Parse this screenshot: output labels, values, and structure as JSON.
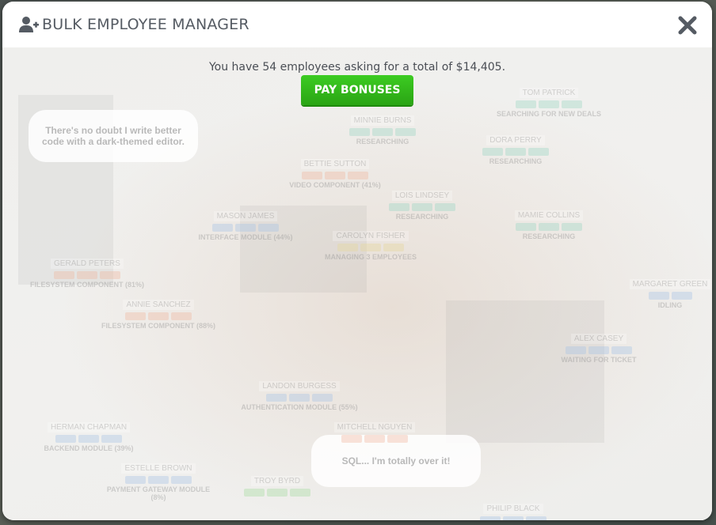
{
  "modal": {
    "title": "BULK EMPLOYEE MANAGER",
    "icon": "add-user-icon",
    "close_icon": "close-icon"
  },
  "summary": {
    "text": "You have 54 employees asking for a total of $14,405."
  },
  "actions": {
    "pay_label": "PAY BONUSES"
  },
  "colors": {
    "accent_green": "#33bb1a",
    "title_gray": "#555b63"
  },
  "background": {
    "bubbles": [
      "There's no doubt I write better code with a dark-themed editor.",
      "SQL... I'm totally over it!"
    ],
    "employees": [
      {
        "name": "TOM PATRICK",
        "task": "SEARCHING FOR NEW DEALS"
      },
      {
        "name": "MINNIE BURNS",
        "task": "RESEARCHING"
      },
      {
        "name": "DORA PERRY",
        "task": "RESEARCHING"
      },
      {
        "name": "BETTIE SUTTON",
        "task": "VIDEO COMPONENT (41%)"
      },
      {
        "name": "LOIS LINDSEY",
        "task": "RESEARCHING"
      },
      {
        "name": "MASON JAMES",
        "task": "INTERFACE MODULE (44%)"
      },
      {
        "name": "CAROLYN FISHER",
        "task": "MANAGING 3 EMPLOYEES"
      },
      {
        "name": "MAMIE COLLINS",
        "task": "RESEARCHING"
      },
      {
        "name": "GERALD PETERS",
        "task": "FILESYSTEM COMPONENT (81%)"
      },
      {
        "name": "ANNIE SANCHEZ",
        "task": "FILESYSTEM COMPONENT (88%)"
      },
      {
        "name": "MARGARET GREEN",
        "task": "IDLING"
      },
      {
        "name": "ALEX CASEY",
        "task": "WAITING FOR TICKET"
      },
      {
        "name": "LANDON BURGESS",
        "task": "AUTHENTICATION MODULE (55%)"
      },
      {
        "name": "HERMAN CHAPMAN",
        "task": "BACKEND MODULE (39%)"
      },
      {
        "name": "MITCHELL NGUYEN",
        "task": ""
      },
      {
        "name": "ESTELLE BROWN",
        "task": "PAYMENT GATEWAY MODULE (8%)"
      },
      {
        "name": "TROY BYRD",
        "task": ""
      },
      {
        "name": "PHILIP BLACK",
        "task": ""
      }
    ]
  }
}
